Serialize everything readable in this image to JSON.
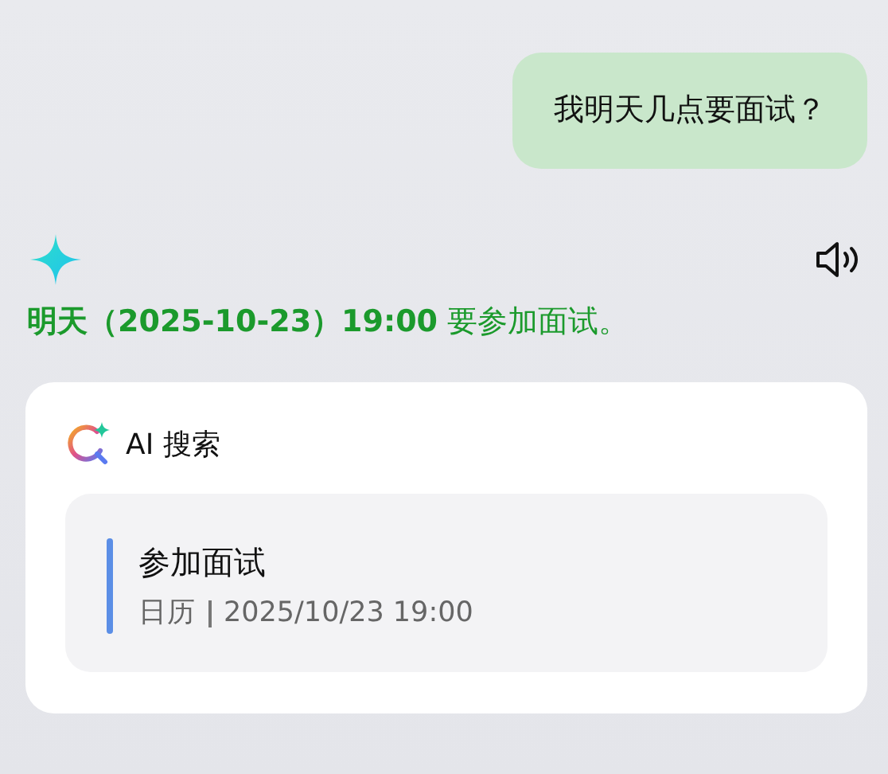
{
  "user_message": {
    "text": "我明天几点要面试？"
  },
  "answer": {
    "text": "**明天（2025-10-23）19:00** 要参加面试。"
  },
  "search_card": {
    "title": "AI 搜索",
    "results": [
      {
        "title": "参加面试",
        "source": "日历",
        "time": "2025/10/23 19:00",
        "color": "#5b8ee6"
      }
    ]
  }
}
